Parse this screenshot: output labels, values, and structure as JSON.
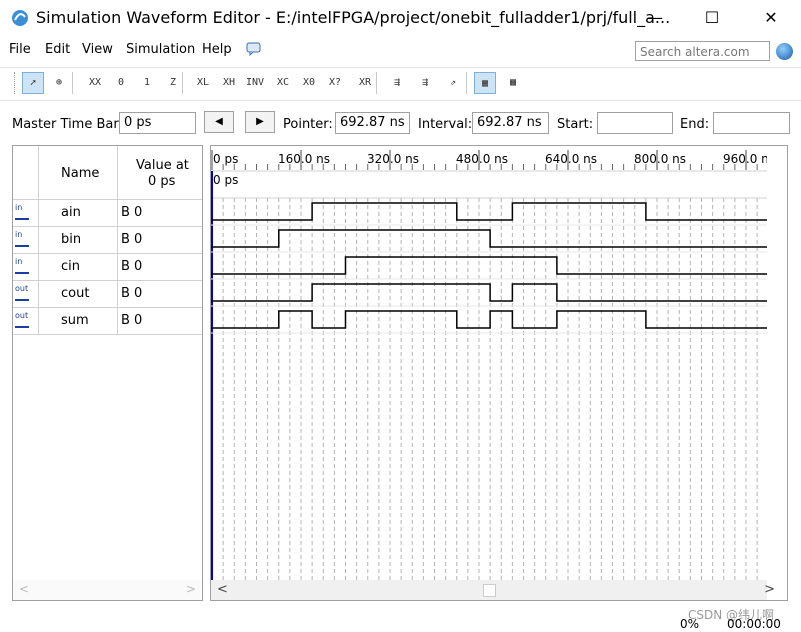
{
  "window": {
    "title": "Simulation Waveform Editor - E:/intelFPGA/project/onebit_fulladder1/prj/full_a...",
    "minimize": "—",
    "maximize": "☐",
    "close": "✕"
  },
  "menu": {
    "file": "File",
    "edit": "Edit",
    "view": "View",
    "simulation": "Simulation",
    "help": "Help"
  },
  "search": {
    "placeholder": "Search altera.com"
  },
  "timebar": {
    "master_label": "Master Time Bar:",
    "master_value": "0 ps",
    "pointer_label": "Pointer:",
    "pointer_value": "692.87 ns",
    "interval_label": "Interval:",
    "interval_value": "692.87 ns",
    "start_label": "Start:",
    "start_value": "",
    "end_label": "End:",
    "end_value": ""
  },
  "table": {
    "name_header": "Name",
    "value_header_line1": "Value at",
    "value_header_line2": "0 ps"
  },
  "signals": [
    {
      "type": "in",
      "name": "ain",
      "value": "B 0"
    },
    {
      "type": "in",
      "name": "bin",
      "value": "B 0"
    },
    {
      "type": "in",
      "name": "cin",
      "value": "B 0"
    },
    {
      "type": "out",
      "name": "cout",
      "value": "B 0"
    },
    {
      "type": "out",
      "name": "sum",
      "value": "B 0"
    }
  ],
  "time_axis": {
    "labels": [
      "0 ps",
      "160.0 ns",
      "320.0 ns",
      "480.0 ns",
      "640.0 ns",
      "800.0 ns",
      "960.0 ns"
    ],
    "cursor_label": "0 ps"
  },
  "waveforms": [
    {
      "name": "ain",
      "transitions_ns": [
        180,
        440,
        540,
        780
      ]
    },
    {
      "name": "bin",
      "transitions_ns": [
        120,
        500
      ]
    },
    {
      "name": "cin",
      "transitions_ns": [
        240,
        620
      ]
    },
    {
      "name": "cout",
      "transitions_ns": [
        180,
        500,
        540,
        620
      ]
    },
    {
      "name": "sum",
      "transitions_ns": [
        120,
        180,
        240,
        440,
        500,
        540,
        620,
        780
      ]
    }
  ],
  "status": {
    "progress": "0%",
    "time": "00:00:00",
    "watermark": "CSDN @纬儿啊"
  },
  "toolbar_icons": [
    "select-pointer-icon",
    "zoom-icon",
    "uninitialized-icon",
    "force-low-icon",
    "force-high-icon",
    "high-impedance-icon",
    "weak-low-icon",
    "weak-high-icon",
    "invert-icon",
    "count-value-icon",
    "overwrite-clock-icon",
    "arbitrary-value-icon",
    "random-value-icon",
    "run-functional-icon",
    "run-timing-icon",
    "generate-netlist-icon",
    "grid-snap-icon",
    "group-icon"
  ],
  "colors": {
    "cursor": "#0000cc",
    "wave": "#000000",
    "grid": "#b4b4b4"
  }
}
